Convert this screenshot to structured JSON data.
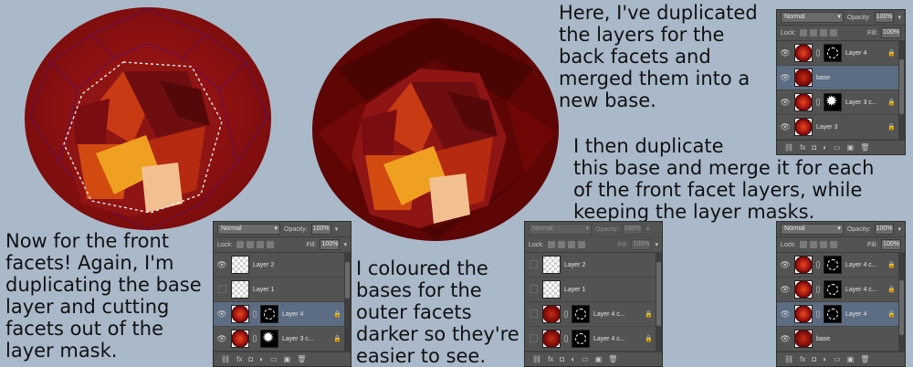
{
  "captions": {
    "front_facets": "Now for the front\nfacets! Again, I'm\nduplicating the base\nlayer and cutting\nfacets out of the\nlayer mask.",
    "outer_facets": "I coloured the\nbases for the\nouter facets\ndarker so they're\neasier to see.",
    "duplicated": "Here, I've duplicated\nthe layers for the\nback facets and\nmerged them into a\nnew base.",
    "merge_each": "I then duplicate\nthis base and merge it for each\nof the front facet layers, while\nkeeping the layer masks."
  },
  "panel_common": {
    "blend_mode": "Normal",
    "opacity_label": "Opacity:",
    "opacity_value": "100%",
    "lock_label": "Lock:",
    "fill_label": "Fill:",
    "fill_value": "100%"
  },
  "panels": {
    "p1": {
      "layers": [
        "Layer 2",
        "Layer 1",
        "Layer 4",
        "Layer 3 c..."
      ]
    },
    "p2": {
      "layers": [
        "Layer 2",
        "Layer 1",
        "Layer 4 c...",
        "Layer 4 c..."
      ]
    },
    "p3": {
      "layers": [
        "Layer 4",
        "base",
        "Layer 3 c...",
        "Layer 3"
      ]
    },
    "p4": {
      "layers": [
        "Layer 4 c...",
        "Layer 4 c...",
        "Layer 4",
        "base"
      ]
    }
  },
  "icons": [
    "eye-icon",
    "chain-link-icon",
    "lock-icon",
    "fx-icon",
    "new-layer-icon",
    "trash-icon"
  ],
  "colors": {
    "background": "#a9b9c9",
    "panel": "#535353",
    "selected_row": "#5c6c82",
    "gem_dark": "#5a0606",
    "gem_mid": "#8e1212"
  }
}
